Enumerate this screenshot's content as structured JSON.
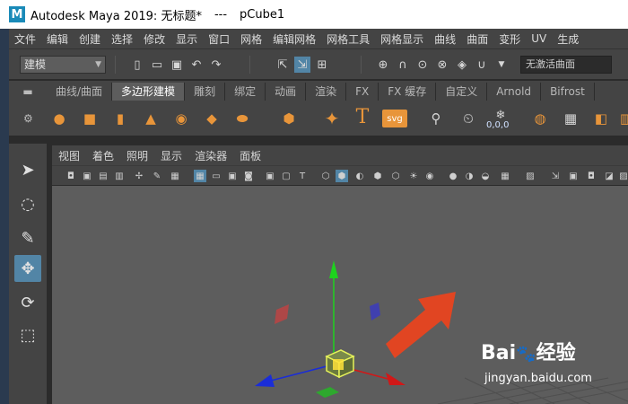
{
  "window": {
    "title": "Autodesk Maya 2019: 无标题*",
    "separator": "---",
    "object": "pCube1"
  },
  "menubar": [
    "文件",
    "编辑",
    "创建",
    "选择",
    "修改",
    "显示",
    "窗口",
    "网格",
    "编辑网格",
    "网格工具",
    "网格显示",
    "曲线",
    "曲面",
    "变形",
    "UV",
    "生成"
  ],
  "statusline": {
    "mode": "建模",
    "object_field_placeholder": "无激活曲面"
  },
  "shelf": {
    "tabs": [
      "曲线/曲面",
      "多边形建模",
      "雕刻",
      "绑定",
      "动画",
      "渲染",
      "FX",
      "FX 缓存",
      "自定义",
      "Arnold",
      "Bifrost"
    ],
    "active_tab": "多边形建模",
    "text_tool": "T",
    "svg_tool": "svg",
    "counter": "0,0,0"
  },
  "panel": {
    "menu": [
      "视图",
      "着色",
      "照明",
      "显示",
      "渲染器",
      "面板"
    ]
  },
  "watermark": {
    "brand": "Bai",
    "brand_suffix": "经验",
    "url": "jingyan.baidu.com"
  },
  "colors": {
    "accent": "#5285a6",
    "shelf_icon": "#e8953a",
    "arrow": "#e8431f",
    "axis_x": "#d01818",
    "axis_y": "#1ed21e",
    "axis_z": "#1a2dd8"
  }
}
